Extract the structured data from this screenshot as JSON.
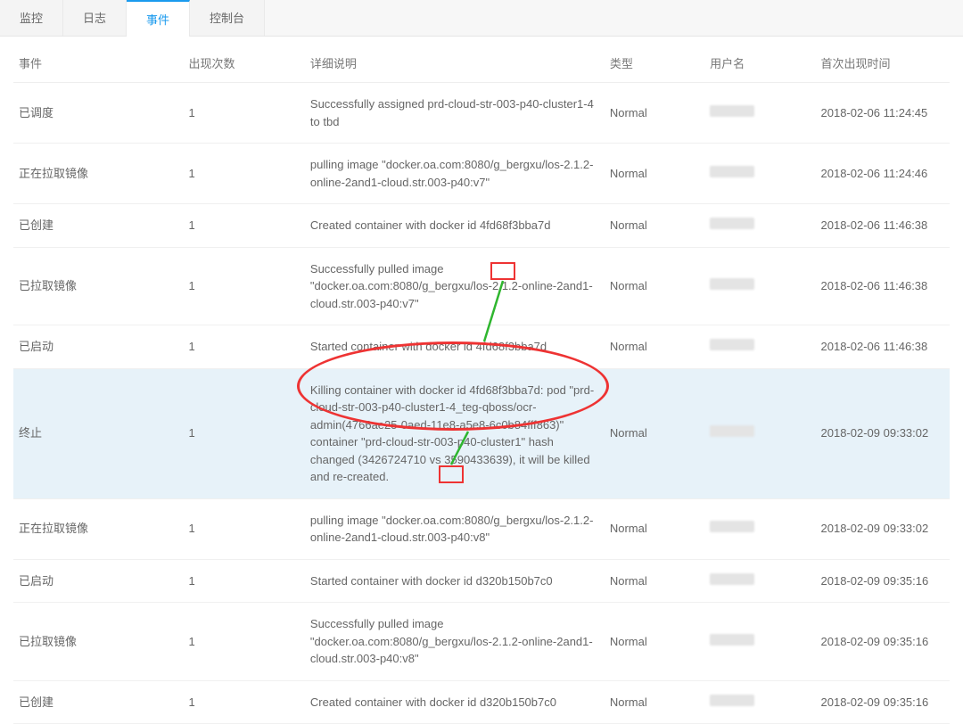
{
  "tabs": [
    {
      "label": "监控"
    },
    {
      "label": "日志"
    },
    {
      "label": "事件",
      "active": true
    },
    {
      "label": "控制台"
    }
  ],
  "columns": {
    "event": "事件",
    "count": "出现次数",
    "detail": "详细说明",
    "type": "类型",
    "user": "用户名",
    "time": "首次出现时间"
  },
  "rows": [
    {
      "event": "已调度",
      "count": "1",
      "detail": "Successfully assigned prd-cloud-str-003-p40-cluster1-4 to tbd",
      "type": "Normal",
      "time": "2018-02-06 11:24:45",
      "highlight": false
    },
    {
      "event": "正在拉取镜像",
      "count": "1",
      "detail": "pulling image \"docker.oa.com:8080/g_bergxu/los-2.1.2-online-2and1-cloud.str.003-p40:v7\"",
      "type": "Normal",
      "time": "2018-02-06 11:24:46",
      "highlight": false
    },
    {
      "event": "已创建",
      "count": "1",
      "detail": "Created container with docker id 4fd68f3bba7d",
      "type": "Normal",
      "time": "2018-02-06 11:46:38",
      "highlight": false
    },
    {
      "event": "已拉取镜像",
      "count": "1",
      "detail": "Successfully pulled image \"docker.oa.com:8080/g_bergxu/los-2.1.2-online-2and1-cloud.str.003-p40:v7\"",
      "type": "Normal",
      "time": "2018-02-06 11:46:38",
      "highlight": false
    },
    {
      "event": "已启动",
      "count": "1",
      "detail": "Started container with docker id 4fd68f3bba7d",
      "type": "Normal",
      "time": "2018-02-06 11:46:38",
      "highlight": false
    },
    {
      "event": "终止",
      "count": "1",
      "detail": "Killing container with docker id 4fd68f3bba7d: pod \"prd-cloud-str-003-p40-cluster1-4_teg-qboss/ocr-admin(4766ae25-0aed-11e8-a5e8-6c0b84fff863)\" container \"prd-cloud-str-003-p40-cluster1\" hash changed (3426724710 vs 3590433639), it will be killed and re-created.",
      "type": "Normal",
      "time": "2018-02-09 09:33:02",
      "highlight": true
    },
    {
      "event": "正在拉取镜像",
      "count": "1",
      "detail": "pulling image \"docker.oa.com:8080/g_bergxu/los-2.1.2-online-2and1-cloud.str.003-p40:v8\"",
      "type": "Normal",
      "time": "2018-02-09 09:33:02",
      "highlight": false
    },
    {
      "event": "已启动",
      "count": "1",
      "detail": "Started container with docker id d320b150b7c0",
      "type": "Normal",
      "time": "2018-02-09 09:35:16",
      "highlight": false
    },
    {
      "event": "已拉取镜像",
      "count": "1",
      "detail": "Successfully pulled image \"docker.oa.com:8080/g_bergxu/los-2.1.2-online-2and1-cloud.str.003-p40:v8\"",
      "type": "Normal",
      "time": "2018-02-09 09:35:16",
      "highlight": false
    },
    {
      "event": "已创建",
      "count": "1",
      "detail": "Created container with docker id d320b150b7c0",
      "type": "Normal",
      "time": "2018-02-09 09:35:16",
      "highlight": false
    }
  ]
}
